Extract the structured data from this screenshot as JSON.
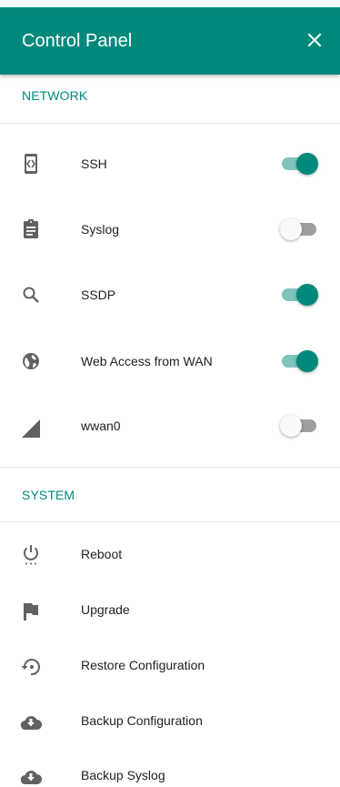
{
  "header": {
    "title": "Control Panel"
  },
  "network": {
    "title": "NETWORK",
    "items": [
      {
        "label": "SSH",
        "icon": "code-icon",
        "enabled": true
      },
      {
        "label": "Syslog",
        "icon": "clipboard-icon",
        "enabled": false
      },
      {
        "label": "SSDP",
        "icon": "search-icon",
        "enabled": true
      },
      {
        "label": "Web Access from WAN",
        "icon": "globe-icon",
        "enabled": true
      },
      {
        "label": "wwan0",
        "icon": "signal-icon",
        "enabled": false
      }
    ]
  },
  "system": {
    "title": "SYSTEM",
    "items": [
      {
        "label": "Reboot",
        "icon": "power-icon"
      },
      {
        "label": "Upgrade",
        "icon": "flag-icon"
      },
      {
        "label": "Restore Configuration",
        "icon": "restore-icon"
      },
      {
        "label": "Backup Configuration",
        "icon": "cloud-download-icon"
      },
      {
        "label": "Backup Syslog",
        "icon": "cloud-download-icon"
      }
    ]
  },
  "colors": {
    "accent": "#00897b",
    "accent_track": "#7fc4bd",
    "off_track": "#9e9e9e",
    "icon": "#616161"
  }
}
